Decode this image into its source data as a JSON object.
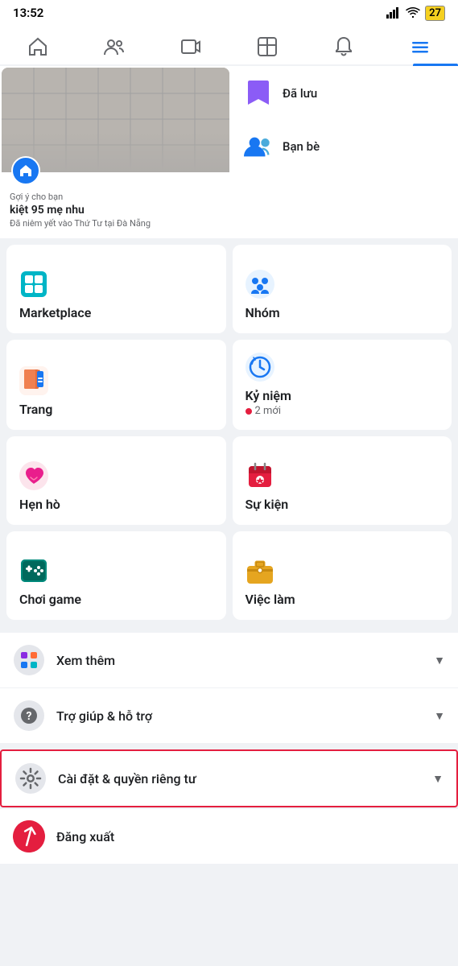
{
  "statusBar": {
    "time": "13:52",
    "battery": "27",
    "signal": "●●●●",
    "wifi": "wifi"
  },
  "navBar": {
    "items": [
      {
        "label": "home",
        "icon": "🏠",
        "active": false
      },
      {
        "label": "friends",
        "icon": "👥",
        "active": false
      },
      {
        "label": "video",
        "icon": "▶",
        "active": false
      },
      {
        "label": "marketplace",
        "icon": "🏪",
        "active": false
      },
      {
        "label": "notifications",
        "icon": "🔔",
        "active": false
      },
      {
        "label": "menu",
        "icon": "☰",
        "active": true
      }
    ]
  },
  "topCard": {
    "suggestion": "Gợi ý cho bạn",
    "title": "kiệt 95 mẹ nhu",
    "subtitle": "Đã niêm yết vào Thứ Tư tại Đà Nẵng"
  },
  "rightCards": [
    {
      "label": "Đã lưu",
      "icon": "bookmark"
    },
    {
      "label": "Bạn bè",
      "icon": "friends"
    }
  ],
  "gridItems": [
    {
      "label": "Marketplace",
      "icon": "marketplace",
      "badge": null,
      "col": 1
    },
    {
      "label": "Nhóm",
      "icon": "nhom",
      "badge": null,
      "col": 2
    },
    {
      "label": "Trang",
      "icon": "trang",
      "badge": null,
      "col": 1
    },
    {
      "label": "Kỷ niệm",
      "icon": "kyniem",
      "badge": "2 mới",
      "col": 2
    },
    {
      "label": "Hẹn hò",
      "icon": "henho",
      "badge": null,
      "col": 1
    },
    {
      "label": "Sự kiện",
      "icon": "sukien",
      "badge": null,
      "col": 2
    },
    {
      "label": "Chơi game",
      "icon": "choigame",
      "badge": null,
      "col": 1
    },
    {
      "label": "Việc làm",
      "icon": "vieclamm",
      "badge": null,
      "col": 2
    }
  ],
  "listItems": [
    {
      "label": "Xem thêm",
      "icon": "grid",
      "expandable": true
    },
    {
      "label": "Trợ giúp & hỗ trợ",
      "icon": "help",
      "expandable": true
    },
    {
      "label": "Cài đặt & quyền riêng tư",
      "icon": "settings",
      "expandable": true
    }
  ],
  "logout": {
    "label": "Đăng xuất"
  }
}
